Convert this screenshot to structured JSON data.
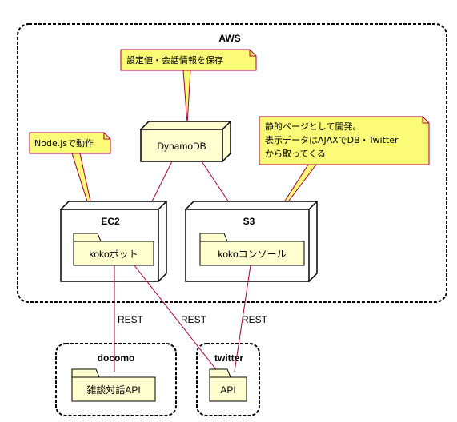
{
  "clouds": {
    "aws": {
      "label": "AWS"
    },
    "docomo": {
      "label": "docomo"
    },
    "twitter": {
      "label": "twitter"
    }
  },
  "nodes": {
    "dynamodb": {
      "label": "DynamoDB"
    },
    "ec2": {
      "label": "EC2"
    },
    "s3": {
      "label": "S3"
    }
  },
  "folders": {
    "koko_bot": {
      "label": "kokoボット"
    },
    "koko_console": {
      "label": "kokoコンソール"
    },
    "docomo_api": {
      "label": "雑談対話API"
    },
    "twitter_api": {
      "label": "API"
    }
  },
  "notes": {
    "settings": {
      "line1": "設定値・会話情報を保存"
    },
    "nodejs": {
      "line1": "Node.jsで動作"
    },
    "console": {
      "line1": "静的ページとして開発。",
      "line2": "表示データはAJAXでDB・Twitter",
      "line3": "から取ってくる"
    }
  },
  "edges": {
    "bot_to_docomo": {
      "label": "REST"
    },
    "bot_to_twitter": {
      "label": "REST"
    },
    "console_to_twitter": {
      "label": "REST"
    }
  },
  "colors": {
    "note_fill": "#FBFB77",
    "note_stroke": "#A80036",
    "folder_fill": "#FEFECE",
    "edge": "#A80036"
  }
}
